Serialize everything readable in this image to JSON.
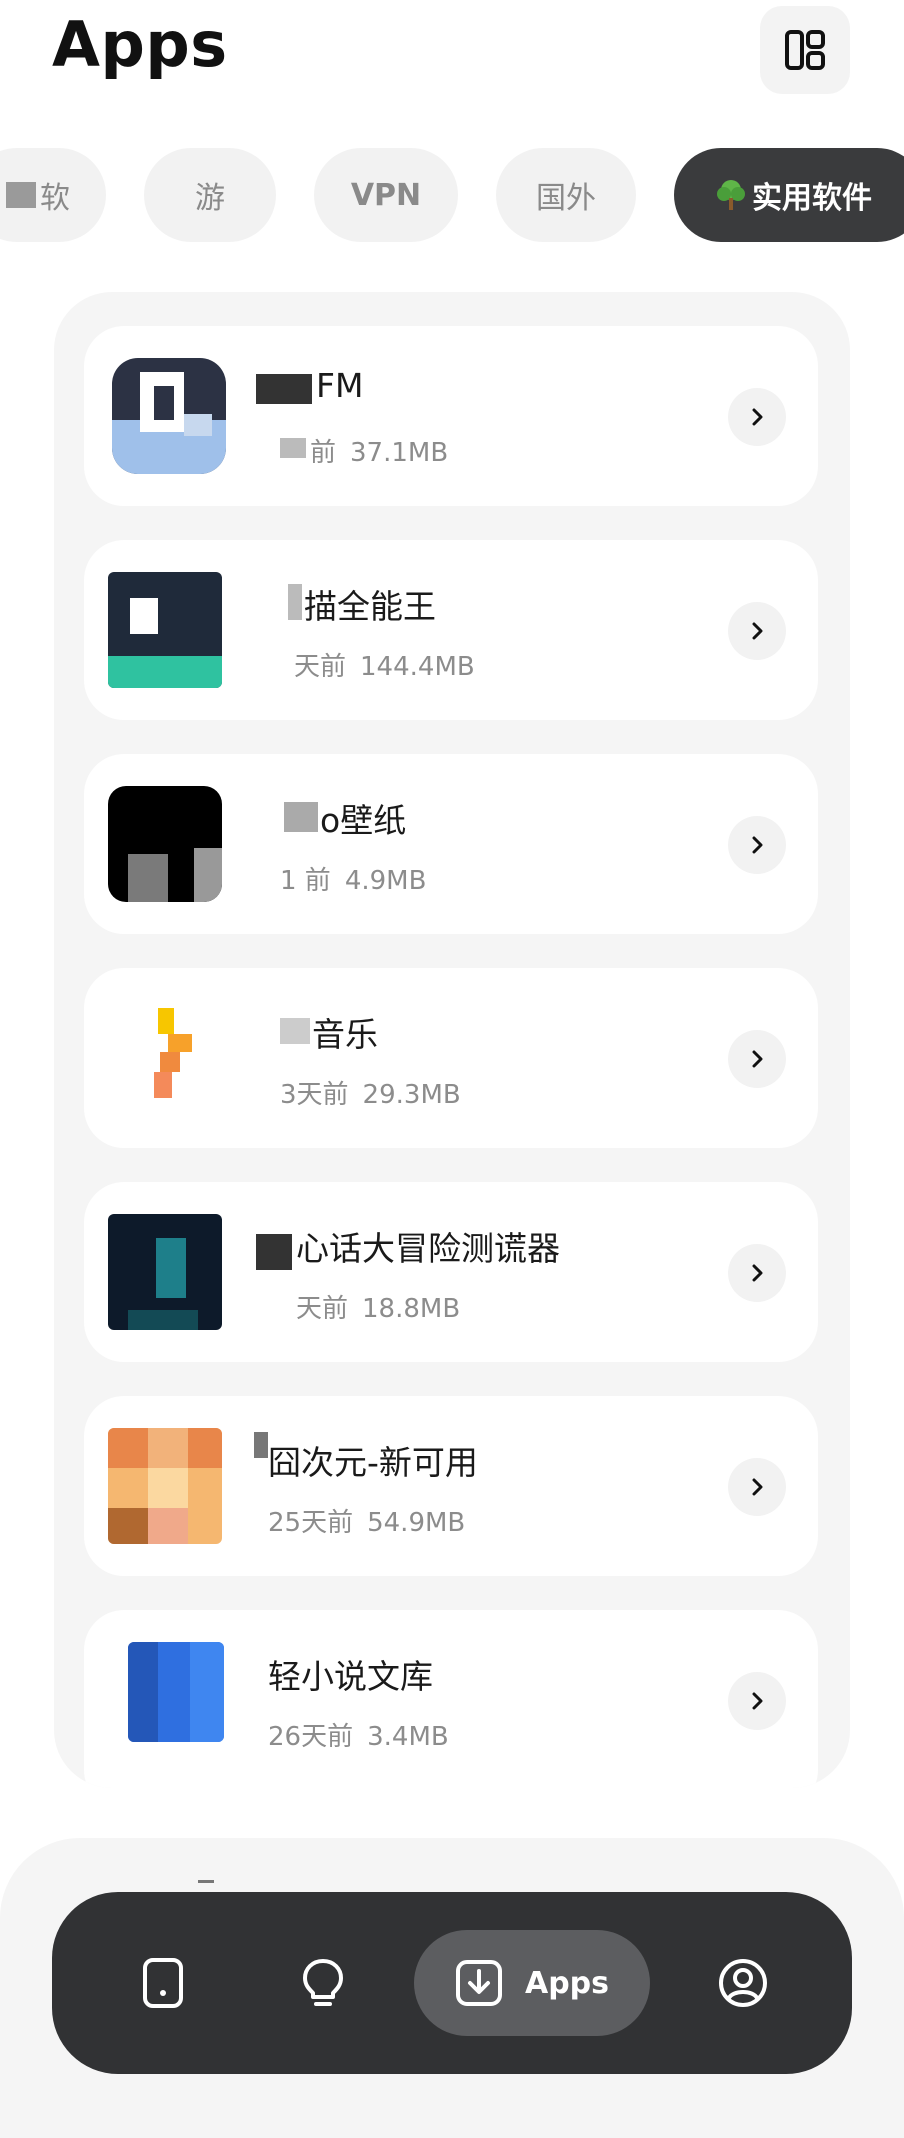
{
  "header": {
    "title": "Apps",
    "layout_button_icon": "layout-grid-icon"
  },
  "categories": [
    {
      "label": "软",
      "active": false
    },
    {
      "label": "游",
      "active": false
    },
    {
      "label": "VPN",
      "active": false
    },
    {
      "label": "国外",
      "active": false
    },
    {
      "label": "实用软件",
      "icon": "tree-emoji-icon",
      "active": true
    }
  ],
  "apps": [
    {
      "name": "FM",
      "time": "前",
      "size": "37.1MB"
    },
    {
      "name": "描全能王",
      "time": "天前",
      "size": "144.4MB"
    },
    {
      "name": "o壁纸",
      "time": "1 前",
      "size": "4.9MB"
    },
    {
      "name": "音乐",
      "time": "3天前",
      "size": "29.3MB"
    },
    {
      "name": "心话大冒险测谎器",
      "time": "天前",
      "size": "18.8MB"
    },
    {
      "name": "囧次元-新可用",
      "time": "25天前",
      "size": "54.9MB"
    },
    {
      "name": "轻小说文库",
      "time": "26天前",
      "size": "3.4MB"
    }
  ],
  "nav": {
    "items": [
      {
        "icon": "phone-icon"
      },
      {
        "icon": "lightbulb-icon"
      },
      {
        "icon": "download-icon",
        "label": "Apps",
        "active": true
      },
      {
        "icon": "user-icon"
      }
    ]
  },
  "colors": {
    "navbar": "#313234",
    "active_chip": "#3a3b3d",
    "panel": "#f5f5f5"
  }
}
